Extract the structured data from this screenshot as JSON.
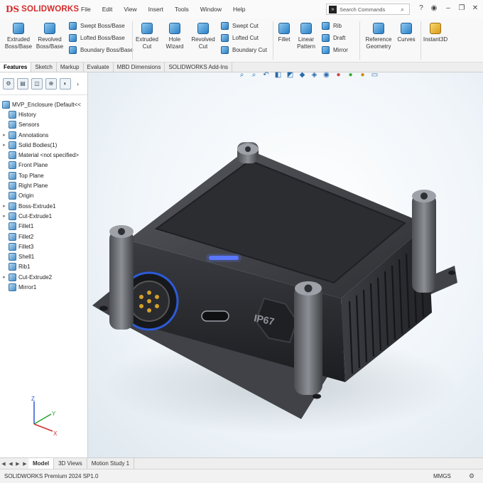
{
  "app": {
    "logo_mark": "DS",
    "logo_text": "SOLIDWORKS",
    "menus": [
      "File",
      "Edit",
      "View",
      "Insert",
      "Tools",
      "Window",
      "Help"
    ],
    "search_placeholder": "Search Commands",
    "search_icon": "solidworks-command-icon",
    "titlebar_icons": [
      "search-icon",
      "help-icon",
      "user-icon",
      "minimize-icon",
      "restore-icon",
      "close-icon"
    ]
  },
  "ribbon": {
    "extruded_boss": "Extruded\nBoss/Base",
    "revolved_boss": "Revolved\nBoss/Base",
    "swept_boss": "Swept Boss/Base",
    "lofted_boss": "Lofted Boss/Base",
    "boundary_boss": "Boundary Boss/Base",
    "extruded_cut": "Extruded\nCut",
    "hole_wizard": "Hole\nWizard",
    "revolved_cut": "Revolved\nCut",
    "swept_cut": "Swept Cut",
    "lofted_cut": "Lofted Cut",
    "boundary_cut": "Boundary Cut",
    "fillet": "Fillet",
    "linear_pattern": "Linear\nPattern",
    "rib": "Rib",
    "draft": "Draft",
    "mirror": "Mirror",
    "reference_geometry": "Reference\nGeometry",
    "curves": "Curves",
    "instant3d": "Instant3D"
  },
  "command_tabs": [
    "Features",
    "Sketch",
    "Markup",
    "Evaluate",
    "MBD Dimensions",
    "SOLIDWORKS Add-Ins"
  ],
  "feature_manager": {
    "tabs": [
      "feature-manager-icon",
      "property-manager-icon",
      "configuration-manager-icon",
      "dimxpert-icon",
      "display-manager-icon"
    ],
    "part_name": "MVP_Enclosure  (Default<<",
    "tree": [
      {
        "label": "History",
        "expand": ""
      },
      {
        "label": "Sensors",
        "expand": ""
      },
      {
        "label": "Annotations",
        "expand": "▸"
      },
      {
        "label": "Solid Bodies(1)",
        "expand": "▸"
      },
      {
        "label": "Material <not specified>",
        "expand": ""
      },
      {
        "label": "Front Plane",
        "expand": ""
      },
      {
        "label": "Top Plane",
        "expand": ""
      },
      {
        "label": "Right Plane",
        "expand": ""
      },
      {
        "label": "Origin",
        "expand": ""
      },
      {
        "label": "Boss-Extrude1",
        "expand": "▸"
      },
      {
        "label": "Cut-Extrude1",
        "expand": "▸"
      },
      {
        "label": "Fillet1",
        "expand": ""
      },
      {
        "label": "Fillet2",
        "expand": ""
      },
      {
        "label": "Fillet3",
        "expand": ""
      },
      {
        "label": "Shell1",
        "expand": ""
      },
      {
        "label": "Rib1",
        "expand": ""
      },
      {
        "label": "Cut-Extrude2",
        "expand": "▸"
      },
      {
        "label": "Mirror1",
        "expand": ""
      }
    ]
  },
  "model": {
    "port_label": "IP67"
  },
  "triad": {
    "x": "X",
    "y": "Y",
    "z": "Z"
  },
  "bottom_tabs": [
    "Model",
    "3D Views",
    "Motion Study 1"
  ],
  "status": {
    "version": "SOLIDWORKS Premium 2024 SP1.0",
    "units": "MMGS"
  },
  "colors": {
    "brand_red": "#d42c2c",
    "accent_blue": "#2b7fc6",
    "led_blue": "#5a78ff"
  }
}
